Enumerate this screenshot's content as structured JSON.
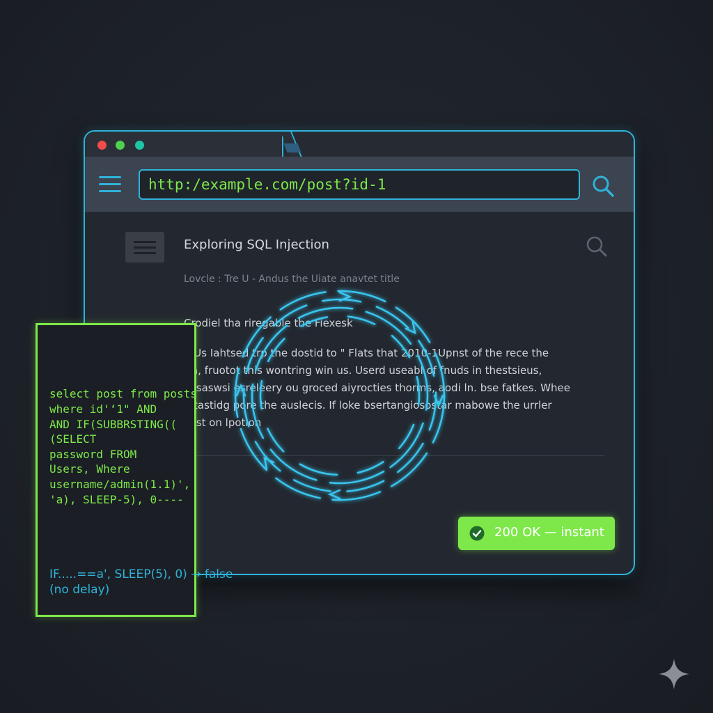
{
  "browser": {
    "url": "http:/example.com/post?id-1"
  },
  "article": {
    "title": "Exploring SQL Injection",
    "meta": "Lovcle : Tre U - Andus the Uiate anavtet title",
    "heading": "Crodiel tha riregable the Fiexesk",
    "body_lines": [
      "·. Us Iahtsed trp the dostid to \" Flats that 2010-1Upnst of the rece the",
      "r a, fruotot this wontring win us. Userd useabl of fnuds in thestsieus,",
      "cusaswsi esreleery ou groced aiyrocties thorms, aodi ln. bse fatkes. Whee",
      "e tastidg pore the auslecis. If loke bsertangiosostar mabowe the urrler",
      "cust on lpotion"
    ]
  },
  "status": {
    "text": "200 OK — instant",
    "color": "#7ee84a"
  },
  "terminal": {
    "code_lines": [
      "select post from posts",
      "where id'‘1\" AND",
      "AND IF(SUBBRSTING((",
      "(SELECT",
      "password FROM",
      "Users, Where",
      "username/admin(1.1)',",
      "'a), SLEEP-5), 0----"
    ],
    "result_lines": [
      "IF.....==a', SLEEP(5),  0) → false",
      "(no delay)"
    ]
  },
  "colors": {
    "accent_cyan": "#2fb3d9",
    "accent_green": "#7ee84a",
    "background": "#1e2229"
  },
  "icons": {
    "menu": "hamburger-menu-icon",
    "search": "search-icon",
    "article": "article-icon",
    "check": "check-circle-icon",
    "spinner": "loading-spinner-icon",
    "sparkle": "sparkle-icon"
  }
}
